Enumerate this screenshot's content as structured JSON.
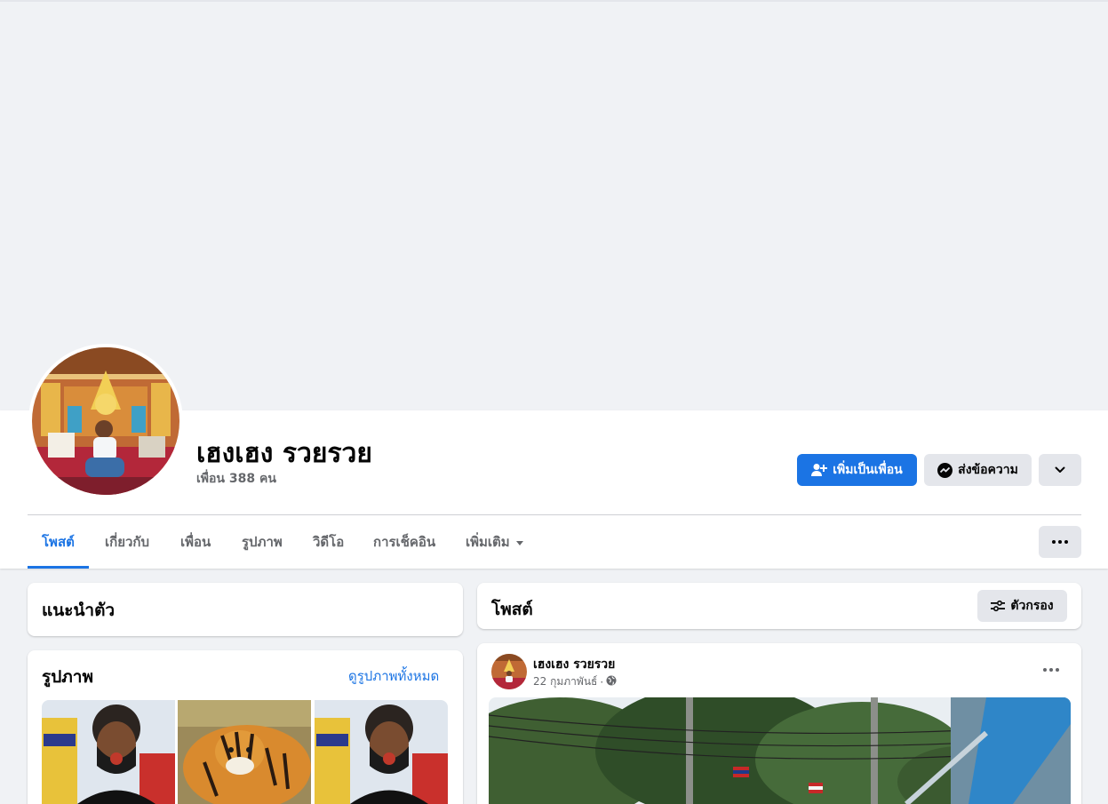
{
  "profile": {
    "name": "เฮงเฮง รวยรวย",
    "friends_text": "เพื่อน 388 คน"
  },
  "actions": {
    "add_friend": "เพิ่มเป็นเพื่อน",
    "message": "ส่งข้อความ"
  },
  "tabs": [
    {
      "label": "โพสต์",
      "active": true
    },
    {
      "label": "เกี่ยวกับ",
      "active": false
    },
    {
      "label": "เพื่อน",
      "active": false
    },
    {
      "label": "รูปภาพ",
      "active": false
    },
    {
      "label": "วิดีโอ",
      "active": false
    },
    {
      "label": "การเช็คอิน",
      "active": false
    },
    {
      "label": "เพิ่มเติม",
      "active": false
    }
  ],
  "intro": {
    "title": "แนะนำตัว"
  },
  "photos": {
    "title": "รูปภาพ",
    "see_all": "ดูรูปภาพทั้งหมด"
  },
  "posts_header": {
    "title": "โพสต์",
    "filter_label": "ตัวกรอง"
  },
  "post": {
    "author": "เฮงเฮง รวยรวย",
    "date": "22 กุมภาพันธ์",
    "separator": "·"
  },
  "colors": {
    "accent": "#1b74e4",
    "page_bg": "#f0f2f5",
    "secondary_button": "#e4e6eb",
    "muted_text": "#65676b"
  },
  "icons": [
    "add-friend-icon",
    "messenger-icon",
    "chevron-down-icon",
    "more-icon",
    "filter-icon",
    "globe-icon",
    "caret-down-icon"
  ]
}
